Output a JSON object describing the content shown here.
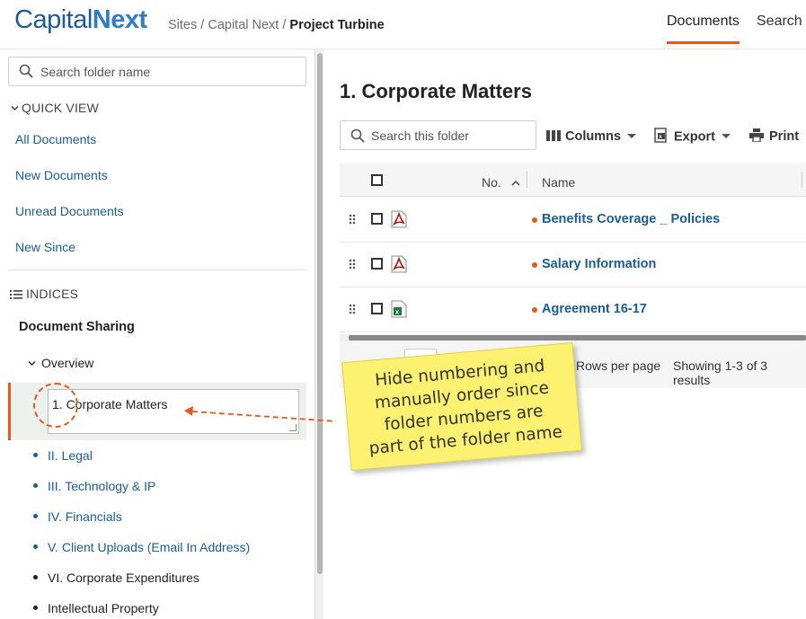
{
  "header": {
    "logo_part1": "Capital",
    "logo_part2": "Next",
    "breadcrumb_sites": "Sites",
    "breadcrumb_sep1": " / ",
    "breadcrumb_site": "Capital Next",
    "breadcrumb_sep2": " / ",
    "breadcrumb_current": "Project Turbine",
    "nav_documents": "Documents",
    "nav_search": "Search"
  },
  "sidebar": {
    "search_placeholder": "Search folder name",
    "quick_view_label": "QUICK VIEW",
    "quick_links": [
      "All Documents",
      "New Documents",
      "Unread Documents",
      "New Since"
    ],
    "indices_label": "INDICES",
    "document_sharing": "Document Sharing",
    "overview": "Overview",
    "editing_value": "1. Corporate Matters",
    "tree": [
      {
        "label": "II. Legal",
        "style": "link"
      },
      {
        "label": "III. Technology & IP",
        "style": "link"
      },
      {
        "label": "IV. Financials",
        "style": "link"
      },
      {
        "label": "V. Client Uploads (Email In Address)",
        "style": "link"
      },
      {
        "label": "VI. Corporate Expenditures",
        "style": "plain"
      },
      {
        "label": "Intellectual Property",
        "style": "plain"
      }
    ]
  },
  "main": {
    "title": "1. Corporate Matters",
    "search_placeholder": "Search this folder",
    "columns_label": "Columns",
    "export_label": "Export",
    "print_label": "Print",
    "col_no": "No.",
    "col_name": "Name",
    "rows": [
      {
        "name": "Benefits Coverage _ Policies",
        "type": "pdf-icon"
      },
      {
        "name": "Salary Information",
        "type": "pdf-icon"
      },
      {
        "name": "Agreement 16-17",
        "type": "excel-icon"
      }
    ],
    "rows_per_page": "Rows per page",
    "showing": "Showing 1-3 of 3 results"
  },
  "annotation": {
    "note": "Hide numbering and\nmanually order since\nfolder numbers are\npart of the folder name"
  },
  "colors": {
    "accent": "#e8571e",
    "link": "#1a5c97",
    "note": "#fdf171"
  }
}
